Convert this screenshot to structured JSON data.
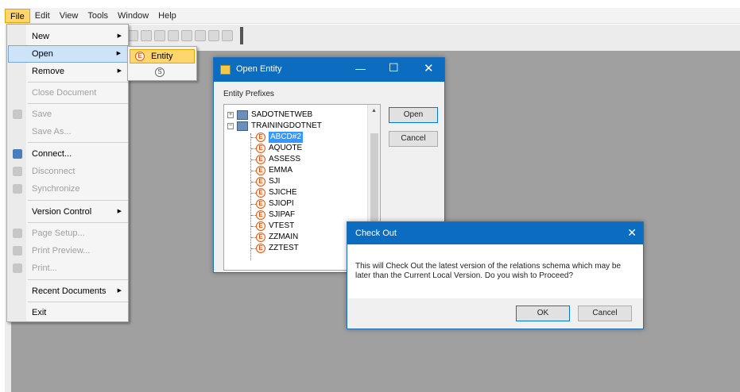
{
  "menubar": {
    "items": [
      "File",
      "Edit",
      "View",
      "Tools",
      "Window",
      "Help"
    ],
    "active": "File"
  },
  "file_menu": {
    "items": [
      {
        "label": "New",
        "submenu": true,
        "enabled": true
      },
      {
        "label": "Open",
        "submenu": true,
        "enabled": true,
        "highlighted": true
      },
      {
        "label": "Remove",
        "submenu": true,
        "enabled": true
      },
      {
        "label": "Close Document",
        "enabled": false
      },
      {
        "label": "Save",
        "enabled": false,
        "icon": "save-icon"
      },
      {
        "label": "Save As...",
        "enabled": false
      },
      {
        "label": "Connect...",
        "enabled": true,
        "icon": "connect-icon"
      },
      {
        "label": "Disconnect",
        "enabled": false,
        "icon": "disconnect-icon"
      },
      {
        "label": "Synchronize",
        "enabled": false,
        "icon": "sync-icon"
      },
      {
        "label": "Version Control",
        "submenu": true,
        "enabled": true
      },
      {
        "label": "Page Setup...",
        "enabled": false,
        "icon": "page-setup-icon"
      },
      {
        "label": "Print Preview...",
        "enabled": false,
        "icon": "print-preview-icon"
      },
      {
        "label": "Print...",
        "enabled": false,
        "icon": "print-icon"
      },
      {
        "label": "Recent Documents",
        "submenu": true,
        "enabled": true
      },
      {
        "label": "Exit",
        "enabled": true
      }
    ]
  },
  "open_submenu": {
    "items": [
      {
        "label": "Entity",
        "icon": "entity-icon",
        "glyph": "E"
      },
      {
        "label": "",
        "icon": "schema-icon",
        "glyph": "S"
      }
    ]
  },
  "open_entity_dialog": {
    "title": "Open Entity",
    "buttons": {
      "minimize": "—",
      "maximize": "☐",
      "close": "✕"
    },
    "label": "Entity Prefixes",
    "tree": {
      "servers": [
        {
          "name": "SADOTNETWEB",
          "expander": "+"
        },
        {
          "name": "TRAININGDOTNET",
          "expander": "−"
        }
      ],
      "entities": [
        "ABCD#2",
        "AQUOTE",
        "ASSESS",
        "EMMA",
        "SJI",
        "SJICHE",
        "SJIOPI",
        "SJIPAF",
        "VTEST",
        "ZZMAIN",
        "ZZTEST"
      ],
      "selected": "ABCD#2",
      "entity_glyph": "E"
    },
    "open_button": "Open",
    "cancel_button": "Cancel"
  },
  "checkout_dialog": {
    "title": "Check Out",
    "close": "✕",
    "message": "This will Check Out the latest version of the relations schema which may be later than the Current Local Version. Do you wish to Proceed?",
    "ok_button": "OK",
    "cancel_button": "Cancel"
  }
}
